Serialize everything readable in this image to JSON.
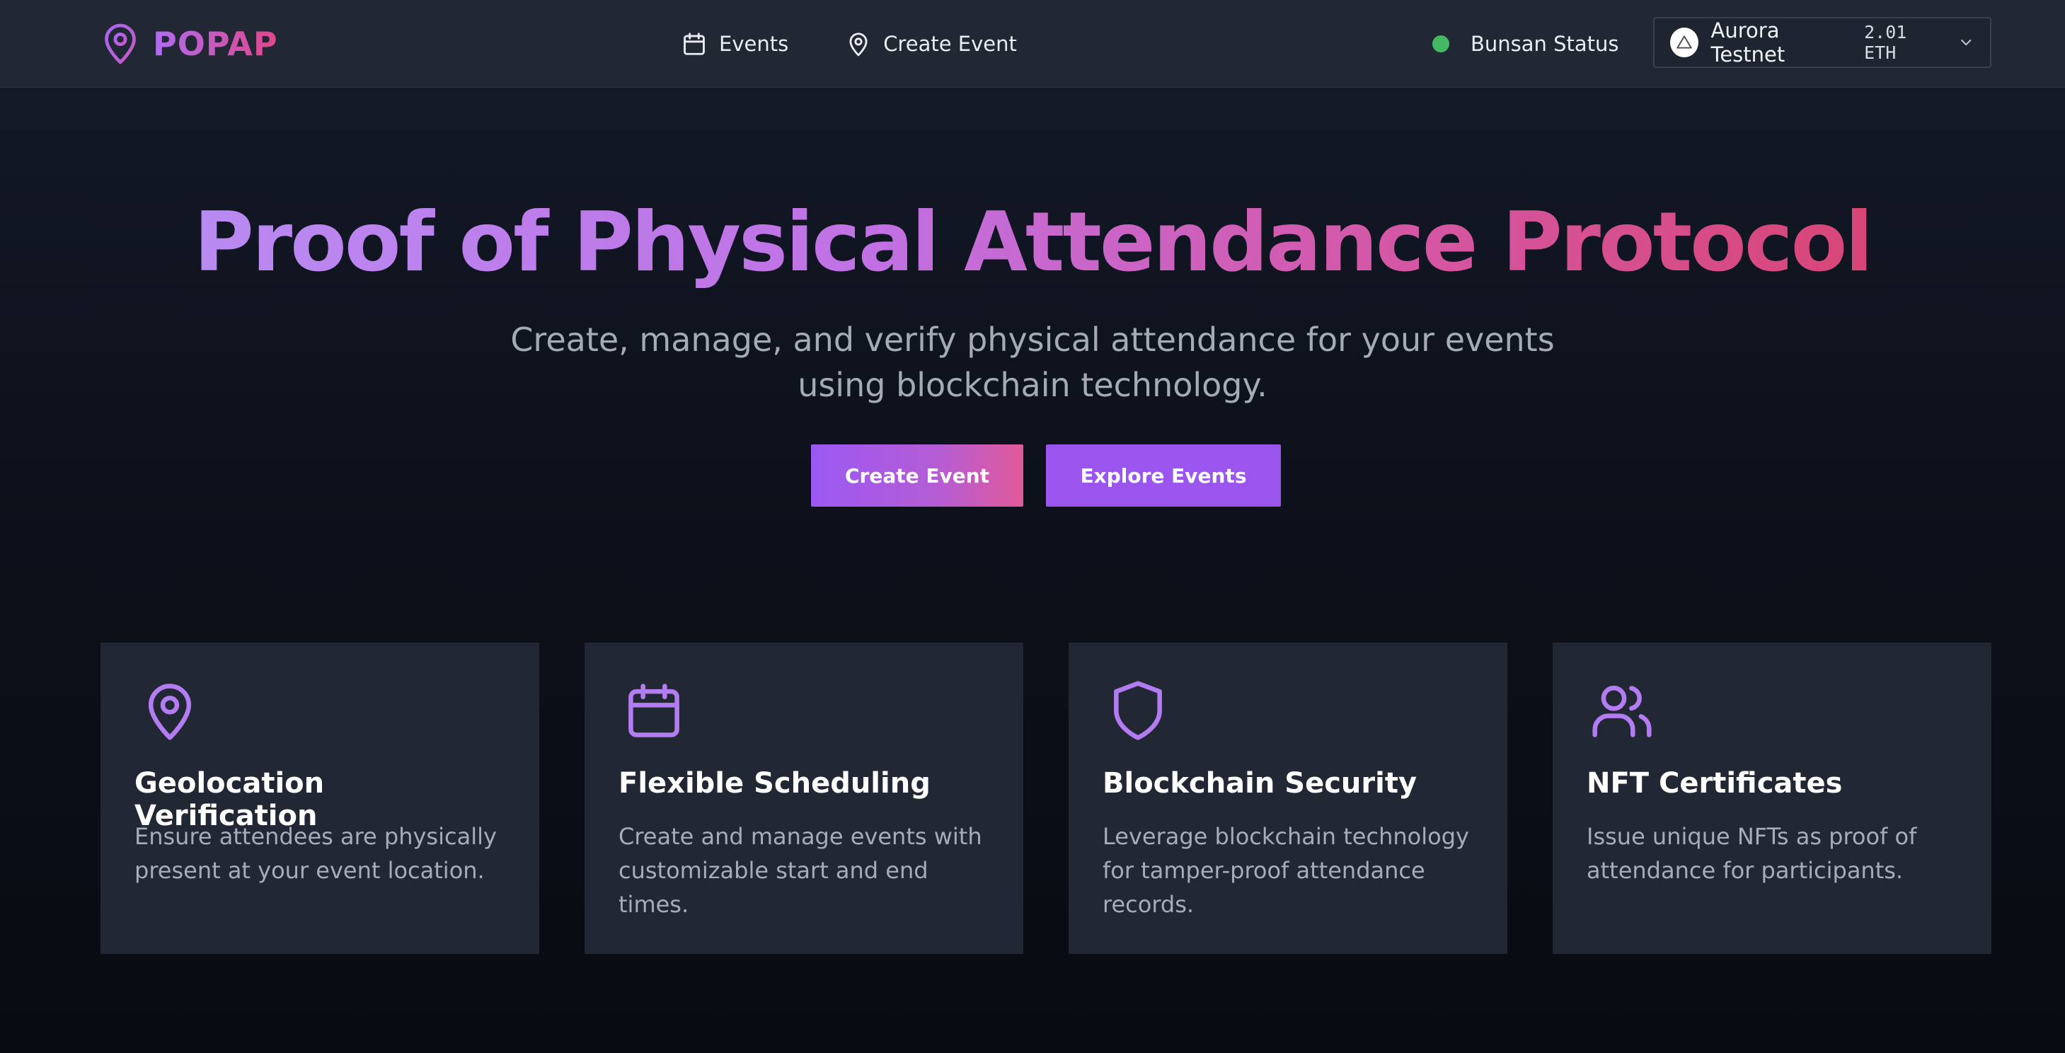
{
  "header": {
    "brand": "POPAP",
    "nav": [
      {
        "label": "Events",
        "icon": "calendar-icon"
      },
      {
        "label": "Create Event",
        "icon": "map-pin-icon"
      }
    ],
    "status": {
      "label": "Bunsan Status",
      "color": "#45b864"
    },
    "wallet": {
      "network": "Aurora Testnet",
      "balance": "2.01 ETH"
    }
  },
  "hero": {
    "title": "Proof of Physical Attendance Protocol",
    "subtitle_line1": "Create, manage, and verify physical attendance for your events",
    "subtitle_line2": "using blockchain technology.",
    "primary_button": "Create Event",
    "secondary_button": "Explore Events"
  },
  "features": [
    {
      "icon": "map-pin-icon",
      "title": "Geolocation Verification",
      "desc_line1": "Ensure attendees are physically",
      "desc_line2": "present at your event location.",
      "desc_line3": ""
    },
    {
      "icon": "calendar-icon",
      "title": "Flexible Scheduling",
      "desc_line1": "Create and manage events with",
      "desc_line2": "customizable start and end",
      "desc_line3": "times."
    },
    {
      "icon": "shield-icon",
      "title": "Blockchain Security",
      "desc_line1": "Leverage blockchain technology",
      "desc_line2": "for tamper-proof attendance",
      "desc_line3": "records."
    },
    {
      "icon": "users-icon",
      "title": "NFT Certificates",
      "desc_line1": "Issue unique NFTs as proof of",
      "desc_line2": "attendance for participants.",
      "desc_line3": ""
    }
  ],
  "colors": {
    "accent": "#9b55ef",
    "gradient_pink": "#e0478a",
    "card_bg": "#212733",
    "header_bg": "#212733",
    "icon_purple": "#b47cf3"
  }
}
